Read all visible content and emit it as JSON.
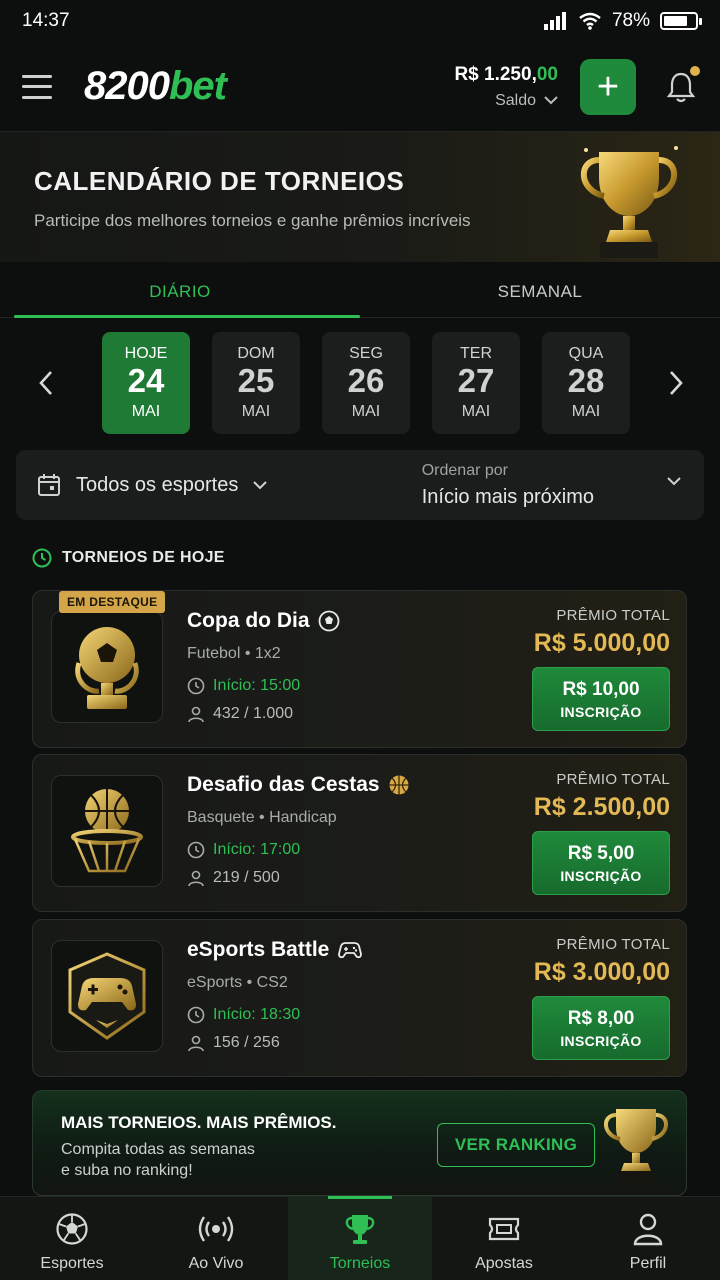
{
  "status": {
    "time": "14:37",
    "battery": "78%",
    "battery_level": 0.78
  },
  "header": {
    "logo_main": "8200",
    "logo_accent": "bet",
    "balance_main": "R$ 1.250,",
    "balance_decimal": "00",
    "balance_label": "Saldo",
    "add_label": "+"
  },
  "hero": {
    "title": "CALENDÁRIO DE TORNEIOS",
    "subtitle": "Participe dos melhores torneios e ganhe prêmios incríveis"
  },
  "tabs": [
    {
      "label": "DIÁRIO",
      "active": true
    },
    {
      "label": "SEMANAL",
      "active": false
    }
  ],
  "dates": [
    {
      "dow": "HOJE",
      "num": "24",
      "mon": "MAI",
      "active": true
    },
    {
      "dow": "DOM",
      "num": "25",
      "mon": "MAI",
      "active": false
    },
    {
      "dow": "SEG",
      "num": "26",
      "mon": "MAI",
      "active": false
    },
    {
      "dow": "TER",
      "num": "27",
      "mon": "MAI",
      "active": false
    },
    {
      "dow": "QUA",
      "num": "28",
      "mon": "MAI",
      "active": false
    }
  ],
  "filter": {
    "sport_value": "Todos os esportes",
    "order_label": "Ordenar por",
    "order_value": "Início mais próximo"
  },
  "section_title": "TORNEIOS DE HOJE",
  "tournaments": [
    {
      "badge": "EM DESTAQUE",
      "name": "Copa do Dia",
      "name_icon": "soccer-ball-icon",
      "category": "Futebol • 1x2",
      "start": "Início: 15:00",
      "players": "432 / 1.000",
      "prize_label": "PRÊMIO TOTAL",
      "prize": "R$ 5.000,00",
      "fee": "R$ 10,00",
      "enroll_label": "INSCRIÇÃO",
      "thumb_icon": "soccer-trophy-icon"
    },
    {
      "badge": "",
      "name": "Desafio das Cestas",
      "name_icon": "basketball-icon",
      "category": "Basquete • Handicap",
      "start": "Início: 17:00",
      "players": "219 / 500",
      "prize_label": "PRÊMIO TOTAL",
      "prize": "R$ 2.500,00",
      "fee": "R$ 5,00",
      "enroll_label": "INSCRIÇÃO",
      "thumb_icon": "basketball-hoop-icon"
    },
    {
      "badge": "",
      "name": "eSports Battle",
      "name_icon": "gamepad-icon",
      "category": "eSports • CS2",
      "start": "Início: 18:30",
      "players": "156 / 256",
      "prize_label": "PRÊMIO TOTAL",
      "prize": "R$ 3.000,00",
      "fee": "R$ 8,00",
      "enroll_label": "INSCRIÇÃO",
      "thumb_icon": "controller-shield-icon"
    }
  ],
  "promo": {
    "title": "MAIS TORNEIOS. MAIS PRÊMIOS.",
    "line1": "Compita todas as semanas",
    "line2": "e suba no ranking!",
    "button": "VER RANKING"
  },
  "nav": [
    {
      "label": "Esportes",
      "icon": "soccer-ball-icon",
      "active": false
    },
    {
      "label": "Ao Vivo",
      "icon": "live-broadcast-icon",
      "active": false
    },
    {
      "label": "Torneios",
      "icon": "trophy-icon",
      "active": true
    },
    {
      "label": "Apostas",
      "icon": "ticket-icon",
      "active": false
    },
    {
      "label": "Perfil",
      "icon": "user-icon",
      "active": false
    }
  ],
  "colors": {
    "accent": "#2fbf55",
    "gold": "#e2b955",
    "background": "#0d0f0e"
  }
}
